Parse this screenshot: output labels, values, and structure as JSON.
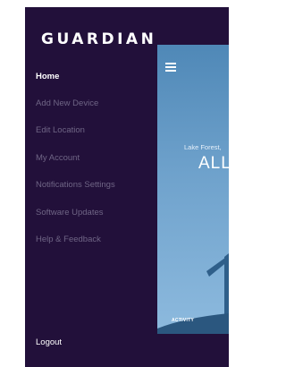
{
  "app": {
    "brand": "GUARDIAN"
  },
  "drawer": {
    "items": [
      {
        "label": "Home",
        "active": true
      },
      {
        "label": "Add New Device",
        "active": false
      },
      {
        "label": "Edit Location",
        "active": false
      },
      {
        "label": "My Account",
        "active": false
      },
      {
        "label": "Notifications Settings",
        "active": false
      },
      {
        "label": "Software Updates",
        "active": false
      },
      {
        "label": "Help & Feedback",
        "active": false
      }
    ],
    "logout_label": "Logout"
  },
  "main": {
    "location": "Lake Forest,",
    "status": "ALL",
    "activity_label": "ACTIVITY",
    "menu_icon": "hamburger-icon"
  },
  "colors": {
    "drawer_bg": "#22103a",
    "inactive_text": "#6f6585",
    "active_text": "#ffffff",
    "sky_top": "#4f88b7",
    "sky_bottom": "#8dbade",
    "house_dark": "#2f5f8a"
  }
}
